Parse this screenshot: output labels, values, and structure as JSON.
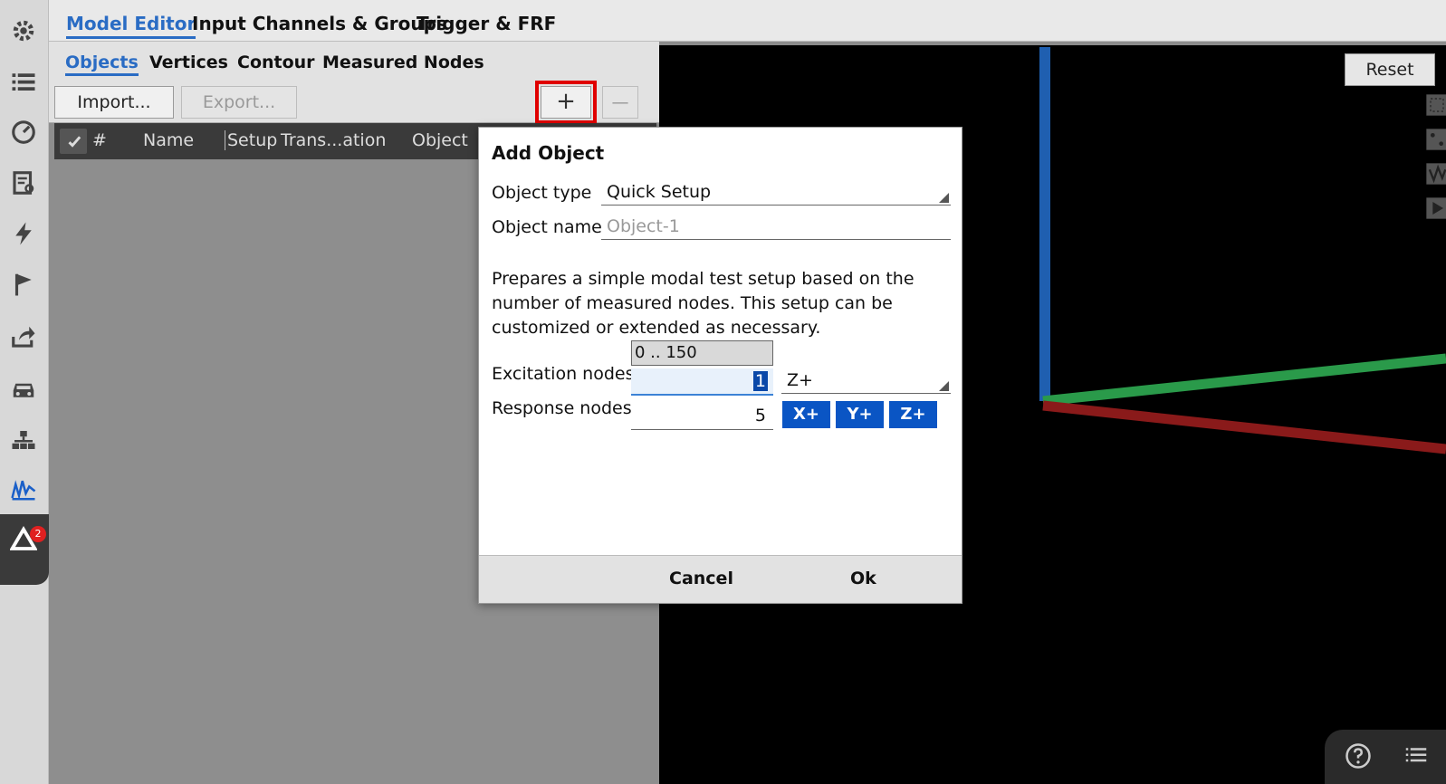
{
  "rail": {
    "icons": [
      "gear-icon",
      "list-icon",
      "gauge-icon",
      "report-icon",
      "lightning-icon",
      "flag-icon",
      "share-icon",
      "car-icon",
      "hierarchy-icon",
      "modal-chart-icon",
      "warning-icon"
    ],
    "badge_count": "2"
  },
  "top_tabs": [
    "Model Editor",
    "Input Channels & Groups",
    "Trigger & FRF"
  ],
  "sub_tabs": [
    "Objects",
    "Vertices",
    "Contour",
    "Measured Nodes"
  ],
  "toolbar": {
    "import_label": "Import...",
    "export_label": "Export...",
    "add_label": "+",
    "remove_label": "—"
  },
  "table": {
    "columns": [
      "#",
      "Name",
      "Setup",
      "Trans...ation",
      "Object"
    ]
  },
  "viewport": {
    "reset_label": "Reset",
    "axis_colors": {
      "y": "#1f5fb0",
      "x": "#2a9a4a",
      "z": "#8a1a1a"
    }
  },
  "dialog": {
    "title": "Add Object",
    "object_type_label": "Object type",
    "object_type_value": "Quick Setup",
    "object_name_label": "Object name",
    "object_name_placeholder": "Object-1",
    "description": "Prepares a simple modal test setup based on the number of measured nodes. This setup can be customized or extended as necessary.",
    "range_hint": "0 .. 150",
    "excitation_label": "Excitation nodes",
    "excitation_value": "1",
    "excitation_direction": "Z+",
    "response_label": "Response nodes",
    "response_value": "5",
    "response_directions": [
      "X+",
      "Y+",
      "Z+"
    ],
    "cancel_label": "Cancel",
    "ok_label": "Ok"
  }
}
